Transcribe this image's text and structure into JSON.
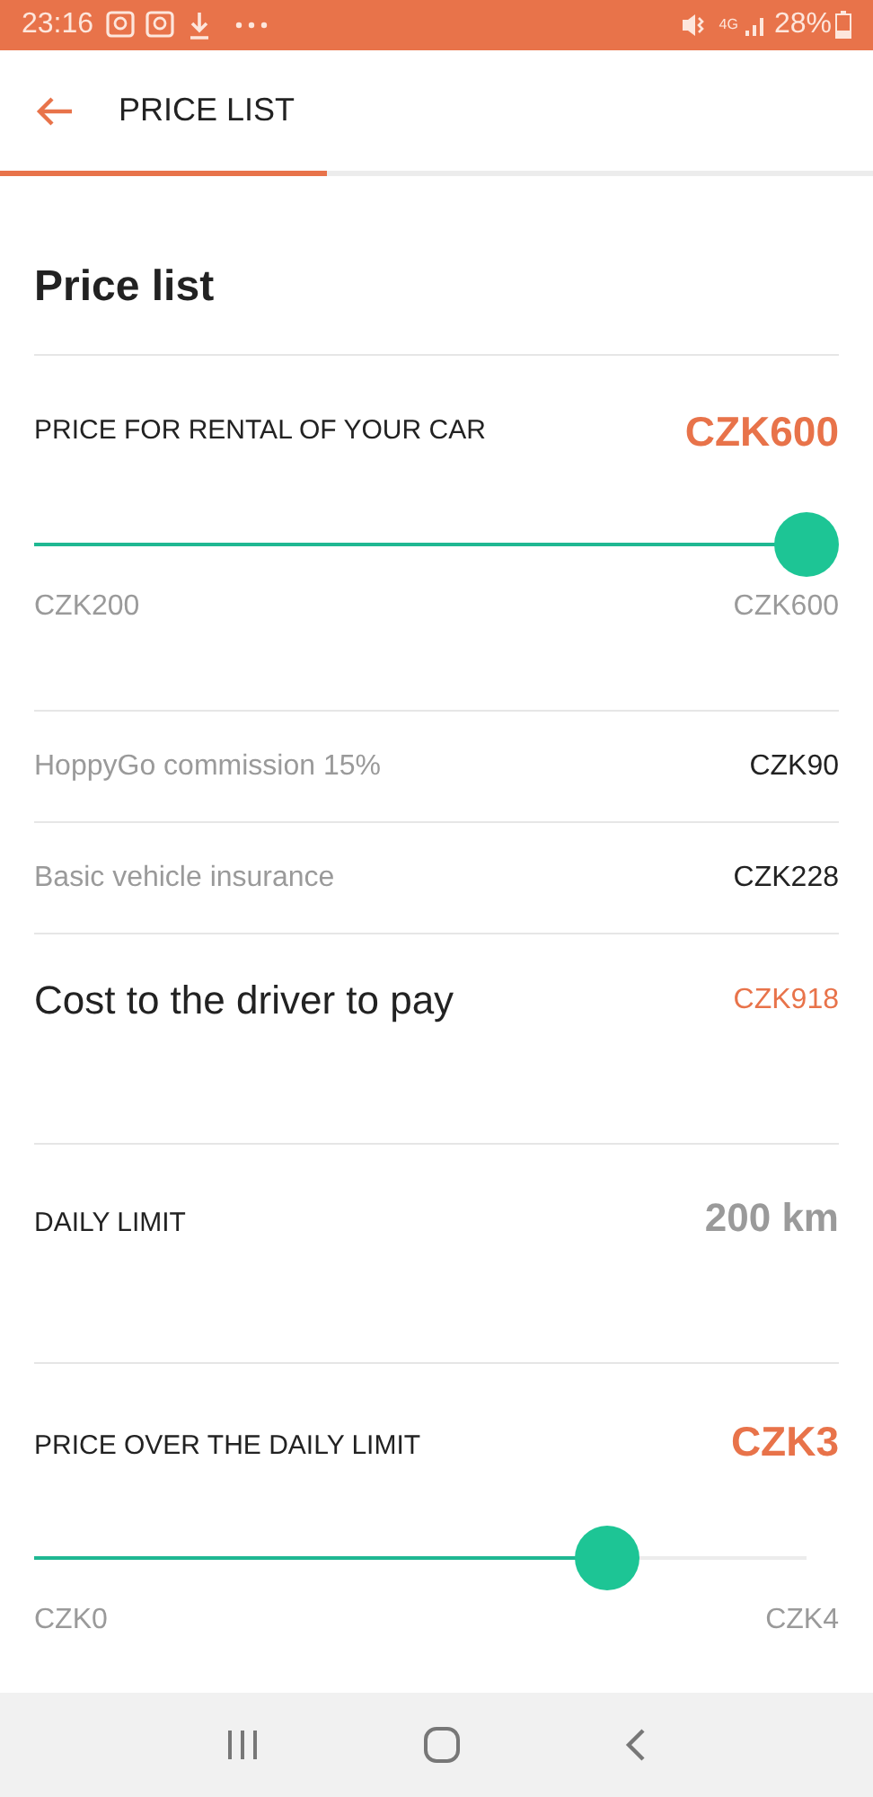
{
  "status_bar": {
    "time": "23:16",
    "network": "4G",
    "battery": "28%"
  },
  "header": {
    "title": "PRICE LIST",
    "progress": {
      "level": 0.375
    }
  },
  "page_title": "Price list",
  "rental": {
    "label": "PRICE FOR RENTAL OF YOUR CAR",
    "value": "CZK600",
    "slider": {
      "level": 1,
      "min_label": "CZK200",
      "max_label": "CZK600"
    }
  },
  "fees": [
    {
      "label": "HoppyGo commission 15%",
      "value": "CZK90"
    },
    {
      "label": "Basic vehicle insurance",
      "value": "CZK228"
    }
  ],
  "total": {
    "label": "Cost to the driver to pay",
    "value": "CZK918"
  },
  "daily_limit": {
    "label": "DAILY LIMIT",
    "value": "200 km"
  },
  "over_limit": {
    "label": "PRICE OVER THE DAILY LIMIT",
    "value": "CZK3",
    "slider": {
      "level": 0.73,
      "min_label": "CZK0",
      "max_label": "CZK4"
    }
  }
}
